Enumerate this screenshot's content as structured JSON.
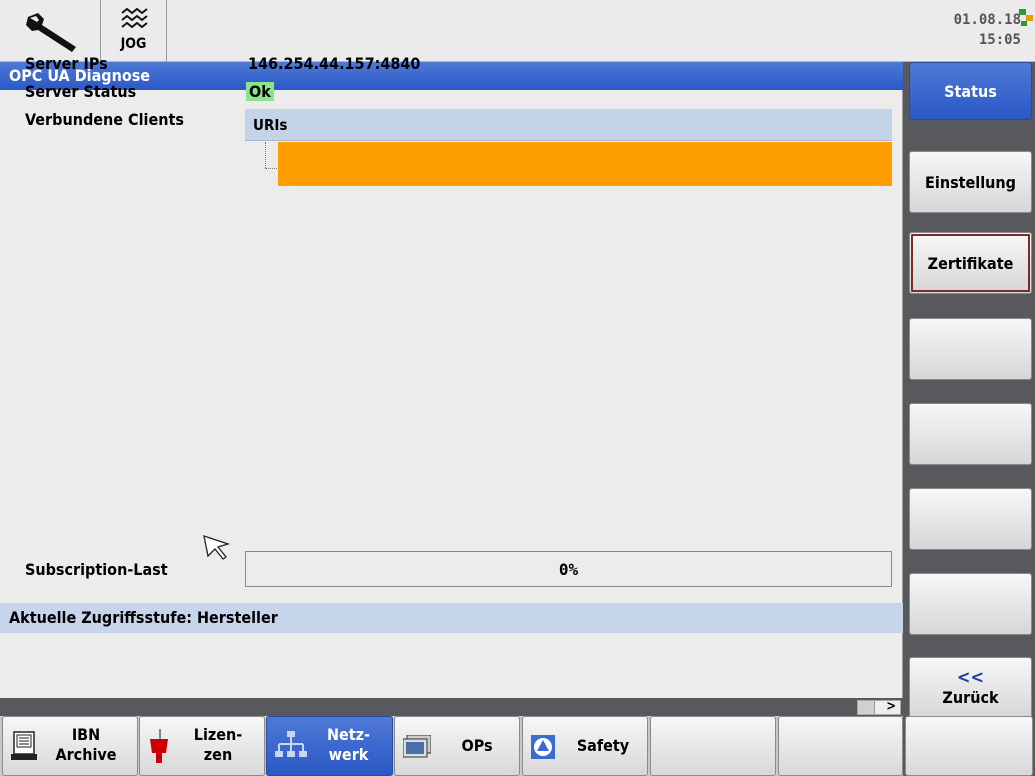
{
  "header": {
    "mode_label": "JOG",
    "date": "01.08.18",
    "time": "15:05"
  },
  "panel": {
    "title": "OPC UA Diagnose",
    "server_ips_label": "Server IPs",
    "server_ips_value": "146.254.44.157:4840",
    "server_status_label": "Server Status",
    "server_status_value": "Ok",
    "clients_label": "Verbundene Clients",
    "uris_header": "URIs",
    "subscription_label": "Subscription-Last",
    "subscription_value": "0%",
    "subscription_fraction": 0,
    "access_level": "Aktuelle Zugriffsstufe: Hersteller"
  },
  "vertical_softkeys": {
    "status": "Status",
    "einstellung": "Einstellung",
    "zertifikate": "Zertifikate",
    "back_chevron": "<<",
    "back": "Zurück"
  },
  "horizontal_softkeys": {
    "ibn_line1": "IBN",
    "ibn_line2": "Archive",
    "lizen_line1": "Lizen-",
    "lizen_line2": "zen",
    "netz_line1": "Netz-",
    "netz_line2": "werk",
    "ops": "OPs",
    "safety": "Safety"
  },
  "colors": {
    "title_blue": "#2a58c6",
    "status_ok_green": "#8ce38a",
    "client_highlight_orange": "#ff9e00",
    "header_row_blue": "#c3d3e8"
  },
  "icons": [
    "wrench-icon",
    "jog-icon",
    "network-status-icon",
    "mouse-cursor-icon",
    "archive-icon",
    "license-icon",
    "network-icon",
    "operator-panel-icon",
    "safety-icon"
  ]
}
